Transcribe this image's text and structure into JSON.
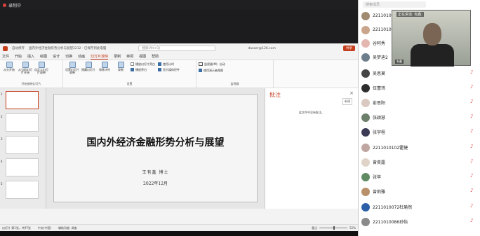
{
  "topbar": {
    "recording": "录制中"
  },
  "ppt": {
    "autosave": "自动保存",
    "filename": "国内外经济金融形势分析与展望2212 - 已保存到此电脑",
    "search_placeholder": "搜索(Alt+Q)",
    "user": "dasaer@126.com",
    "share": "共享",
    "menus": [
      "文件",
      "开始",
      "插入",
      "绘图",
      "设计",
      "切换",
      "动画",
      "幻灯片放映",
      "录制",
      "审阅",
      "视图",
      "帮助"
    ],
    "active_menu": "幻灯片放映",
    "ribbon": {
      "group1_buttons": [
        "从头开始",
        "从当前幻灯片开始",
        "自定义幻灯片放映"
      ],
      "group1_label": "开始放映幻灯片",
      "group2_buttons": [
        "设置幻灯片放映",
        "隐藏幻灯片",
        "排练计时",
        "录制"
      ],
      "group2_label": "设置",
      "checks": [
        "播放旁白",
        "使用计时",
        "显示媒体控件"
      ],
      "check_hidden": "播放幻灯片旁白",
      "monitor_label": "监视器",
      "monitor_value": "自动",
      "presenter_view": "使用演示者视图",
      "monitor_prefix": "监视器(M):"
    },
    "slide": {
      "title": "国内外经济金融形势分析与展望",
      "author": "王有鑫  博士",
      "date": "2022年12月"
    },
    "notes": {
      "title": "批注",
      "new": "新建",
      "empty": "此文件中没有批注。"
    },
    "status": {
      "slide_info": "幻灯片 第1张，共97张",
      "lang": "中文(中国)",
      "accessibility": "辅助功能: 调查",
      "notes": "备注",
      "zoom": "52%"
    }
  },
  "panel": {
    "search_placeholder": "搜索成员",
    "speaking": "正在讲话: 有鑫;",
    "video_name": "有鑫",
    "members": [
      "2211010",
      "2211010",
      "谷阿秀",
      "吴梦迪2",
      "吴思莫",
      "伍蕾玮",
      "俞思阳",
      "张颖慧",
      "张宇程",
      "2211010102霍捷",
      "曾奕露",
      "张苹",
      "曾莉雅",
      "2211010072杜瑜然",
      "2211010086孙怡"
    ]
  }
}
